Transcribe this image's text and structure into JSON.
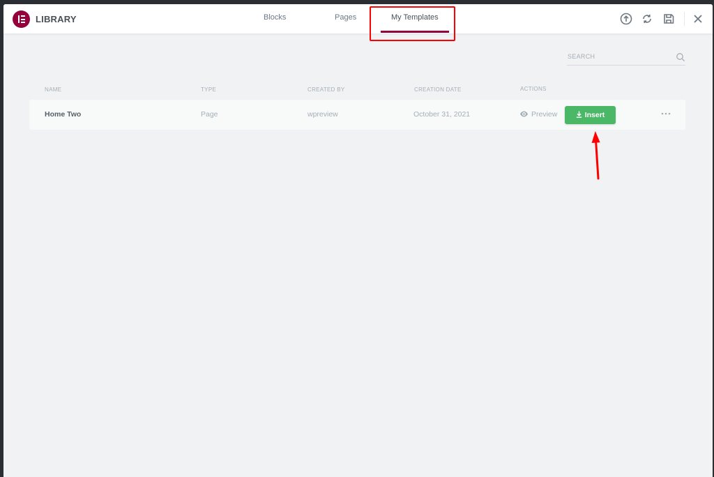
{
  "header": {
    "title": "LIBRARY",
    "tabs": [
      {
        "label": "Blocks",
        "active": false
      },
      {
        "label": "Pages",
        "active": false
      },
      {
        "label": "My Templates",
        "active": true
      }
    ],
    "icons": [
      "upload-icon",
      "sync-icon",
      "save-icon",
      "close-icon"
    ]
  },
  "search": {
    "placeholder": "SEARCH"
  },
  "table": {
    "columns": [
      "NAME",
      "TYPE",
      "CREATED BY",
      "CREATION DATE",
      "ACTIONS"
    ],
    "rows": [
      {
        "name": "Home Two",
        "type": "Page",
        "created_by": "wpreview",
        "creation_date": "October 31, 2021",
        "preview_label": "Preview",
        "insert_label": "Insert"
      }
    ]
  },
  "colors": {
    "brand": "#93003c",
    "insert": "#4ab866",
    "annotation": "#ff0000"
  }
}
